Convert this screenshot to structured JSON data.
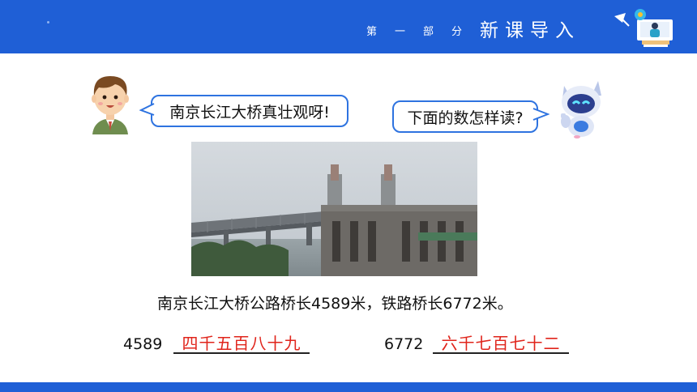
{
  "header": {
    "section_part": "第一部分",
    "section_title": "新课导入",
    "color": "#1f5fd6"
  },
  "speech": {
    "boy": "南京长江大桥真壮观呀!",
    "robot": "下面的数怎样读?"
  },
  "main": {
    "sentence": "南京长江大桥公路桥长4589米，铁路桥长6772米。",
    "items": [
      {
        "number": "4589",
        "answer": "四千五百八十九"
      },
      {
        "number": "6772",
        "answer": "六千七百七十二"
      }
    ],
    "answer_color": "#e0241b"
  }
}
